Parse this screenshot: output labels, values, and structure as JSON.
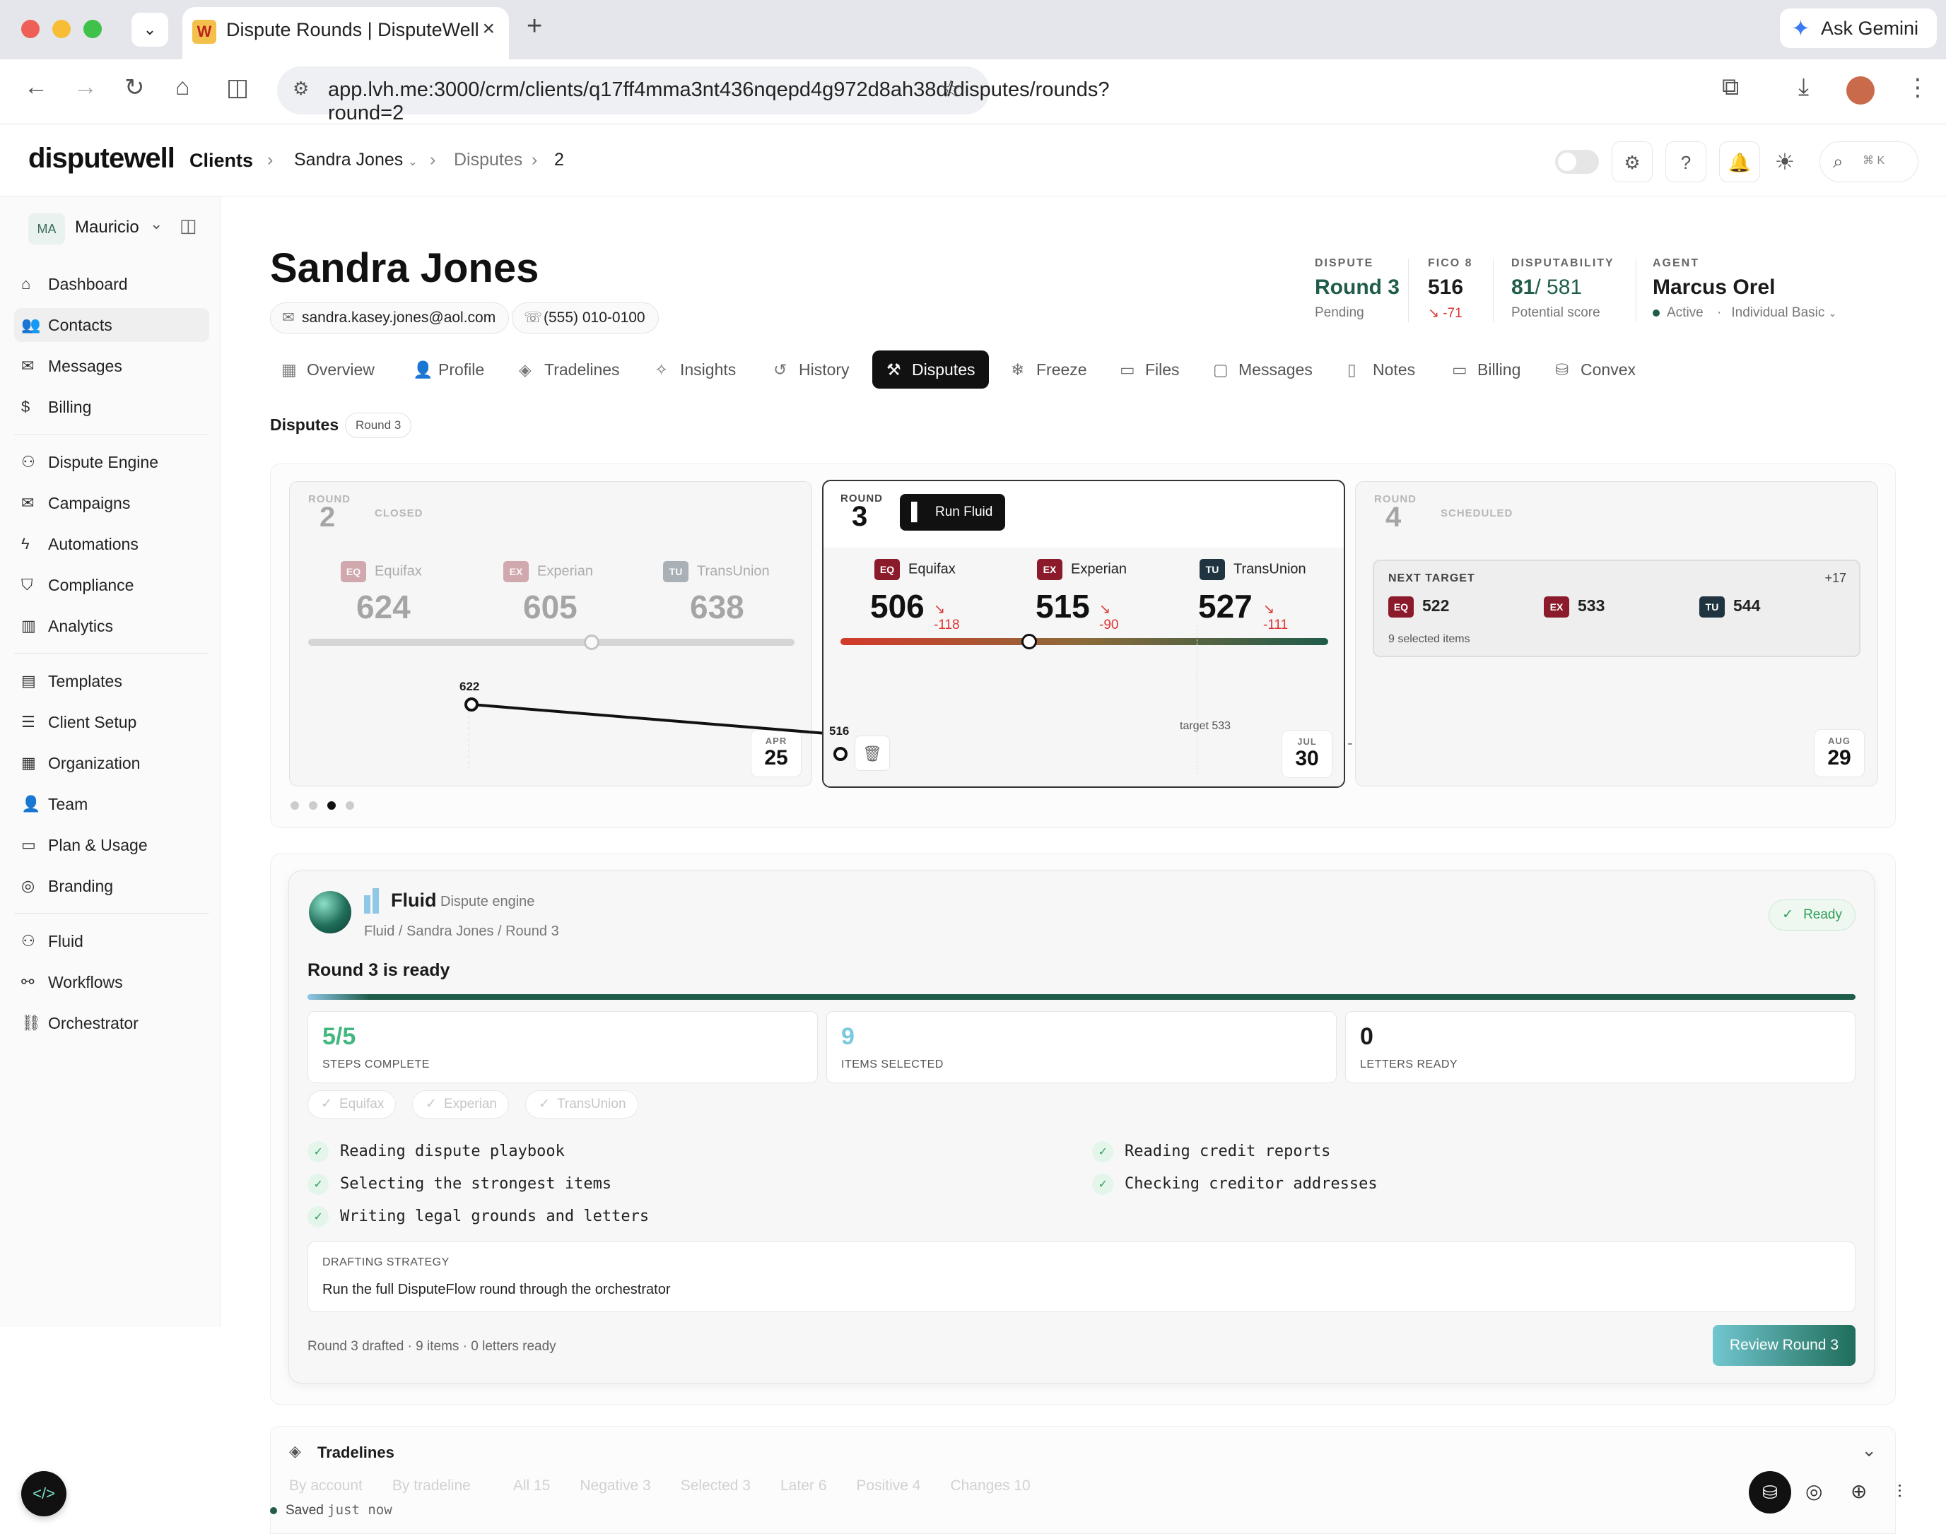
{
  "browser": {
    "tab_title": "Dispute Rounds | DisputeWell",
    "url": "app.lvh.me:3000/crm/clients/q17ff4mma3nt436nqepd4g972d8ah38d/disputes/rounds?round=2",
    "ask_gemini": "Ask Gemini"
  },
  "header": {
    "logo": "disputewell",
    "clients": "Clients",
    "client": "Sandra Jones",
    "disputes": "Disputes",
    "round": "2",
    "search_shortcut": "⌘ K"
  },
  "sidebar": {
    "user_initials": "MA",
    "user_name": "Mauricio",
    "items": [
      {
        "label": "Dashboard",
        "icon": "home-icon"
      },
      {
        "label": "Contacts",
        "icon": "users-icon"
      },
      {
        "label": "Messages",
        "icon": "message-icon"
      },
      {
        "label": "Billing",
        "icon": "dollar-icon"
      },
      {
        "label": "Dispute Engine",
        "icon": "bot-icon"
      },
      {
        "label": "Campaigns",
        "icon": "mail-icon"
      },
      {
        "label": "Automations",
        "icon": "bolt-icon"
      },
      {
        "label": "Compliance",
        "icon": "shield-icon"
      },
      {
        "label": "Analytics",
        "icon": "chart-icon"
      },
      {
        "label": "Templates",
        "icon": "file-icon"
      },
      {
        "label": "Client Setup",
        "icon": "checklist-icon"
      },
      {
        "label": "Organization",
        "icon": "building-icon"
      },
      {
        "label": "Team",
        "icon": "team-icon"
      },
      {
        "label": "Plan & Usage",
        "icon": "card-icon"
      },
      {
        "label": "Branding",
        "icon": "palette-icon"
      },
      {
        "label": "Fluid",
        "icon": "bot-icon"
      },
      {
        "label": "Workflows",
        "icon": "workflow-icon"
      },
      {
        "label": "Orchestrator",
        "icon": "network-icon"
      }
    ]
  },
  "client": {
    "name": "Sandra Jones",
    "email": "sandra.kasey.jones@aol.com",
    "phone": "(555) 010-0100"
  },
  "stats": {
    "dispute": {
      "label": "DISPUTE",
      "value": "Round 3",
      "sub": "Pending"
    },
    "fico": {
      "label": "FICO 8",
      "value": "516",
      "sub": "↘ -71"
    },
    "disputability": {
      "label": "DISPUTABILITY",
      "value": "81",
      "total": "/ 581",
      "sub": "Potential score"
    },
    "agent": {
      "label": "AGENT",
      "value": "Marcus Orel",
      "status": "Active",
      "plan": "Individual Basic"
    }
  },
  "tabs": [
    "Overview",
    "Profile",
    "Tradelines",
    "Insights",
    "History",
    "Disputes",
    "Freeze",
    "Files",
    "Messages",
    "Notes",
    "Billing",
    "Convex"
  ],
  "section": {
    "title": "Disputes",
    "badge": "Round 3"
  },
  "rounds": {
    "round_label": "ROUND",
    "r2": {
      "num": "2",
      "status": "CLOSED",
      "eq": "624",
      "ex": "605",
      "tu": "638",
      "point": "622",
      "month": "APR",
      "day": "25"
    },
    "r3": {
      "num": "3",
      "run": "Run Fluid",
      "eq": "506",
      "eq_d": "-118",
      "ex": "515",
      "ex_d": "-90",
      "tu": "527",
      "tu_d": "-111",
      "point": "516",
      "target": "target 533",
      "month": "JUL",
      "day": "30"
    },
    "r4": {
      "num": "4",
      "status": "SCHEDULED",
      "next_target": "NEXT TARGET",
      "plus": "+17",
      "eq": "522",
      "ex": "533",
      "tu": "544",
      "selected": "9 selected items",
      "month": "AUG",
      "day": "29"
    },
    "bureaus": {
      "eq": "Equifax",
      "ex": "Experian",
      "tu": "TransUnion",
      "eq_tag": "EQ",
      "ex_tag": "EX",
      "tu_tag": "TU"
    },
    "colors": {
      "eq": "#8b1a2b",
      "ex": "#8b1a2b",
      "tu": "#1f3440"
    }
  },
  "fluid": {
    "name": "Fluid",
    "subtitle": "Dispute engine",
    "path": "Fluid / Sandra Jones / Round 3",
    "status": "Ready",
    "heading": "Round 3 is ready",
    "progress": 1.0,
    "boxes": [
      {
        "value": "5/5",
        "label": "STEPS COMPLETE"
      },
      {
        "value": "9",
        "label": "ITEMS SELECTED"
      },
      {
        "value": "0",
        "label": "LETTERS READY"
      }
    ],
    "chips": [
      "Equifax",
      "Experian",
      "TransUnion"
    ],
    "steps_left": [
      "Reading dispute playbook",
      "Selecting the strongest items",
      "Writing legal grounds and letters"
    ],
    "steps_right": [
      "Reading credit reports",
      "Checking creditor addresses"
    ],
    "strategy_label": "DRAFTING STRATEGY",
    "strategy_text": "Run the full DisputeFlow round through the orchestrator",
    "footer": "Round 3 drafted · 9 items · 0 letters ready",
    "review": "Review Round 3"
  },
  "tradelines": {
    "title": "Tradelines",
    "filters": [
      "By account",
      "By tradeline",
      "All 15",
      "Negative 3",
      "Selected 3",
      "Later 6",
      "Positive 4",
      "Changes 10"
    ]
  },
  "footer": {
    "saved": "Saved",
    "when": "just now"
  }
}
